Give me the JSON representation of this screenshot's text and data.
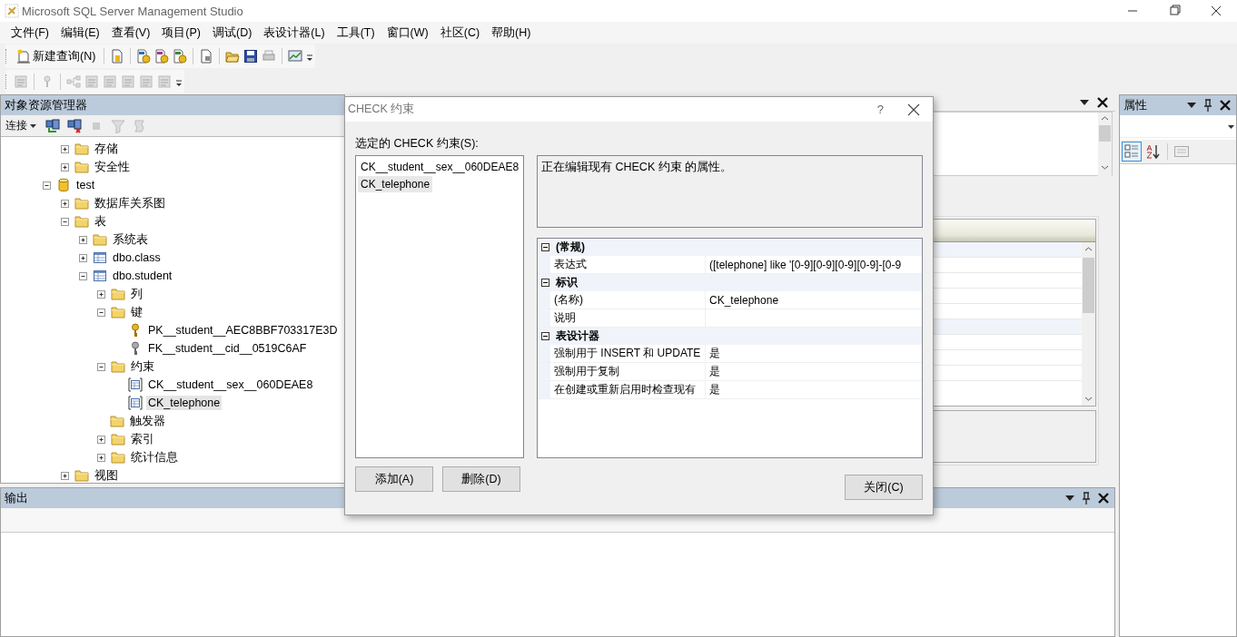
{
  "window": {
    "title": "Microsoft SQL Server Management Studio"
  },
  "menu": [
    {
      "label": "文件(F)"
    },
    {
      "label": "编辑(E)"
    },
    {
      "label": "查看(V)"
    },
    {
      "label": "项目(P)"
    },
    {
      "label": "调试(D)"
    },
    {
      "label": "表设计器(L)"
    },
    {
      "label": "工具(T)"
    },
    {
      "label": "窗口(W)"
    },
    {
      "label": "社区(C)"
    },
    {
      "label": "帮助(H)"
    }
  ],
  "toolbar": {
    "new_query": "新建查询(N)"
  },
  "object_explorer": {
    "title": "对象资源管理器",
    "connect": "连接",
    "tree": {
      "items_above": [
        {
          "label": "存储",
          "kind": "folder",
          "expanded": false
        },
        {
          "label": "安全性",
          "kind": "folder",
          "expanded": false
        }
      ],
      "items": [
        {
          "label": "test",
          "kind": "database",
          "expanded": true,
          "children": [
            {
              "label": "数据库关系图",
              "kind": "folder",
              "expanded": false
            },
            {
              "label": "表",
              "kind": "folder",
              "expanded": true,
              "children": [
                {
                  "label": "系统表",
                  "kind": "folder",
                  "expanded": false
                },
                {
                  "label": "dbo.class",
                  "kind": "table",
                  "expanded": false
                },
                {
                  "label": "dbo.student",
                  "kind": "table",
                  "expanded": true,
                  "children": [
                    {
                      "label": "列",
                      "kind": "folder",
                      "expanded": false
                    },
                    {
                      "label": "键",
                      "kind": "folder",
                      "expanded": true,
                      "children": [
                        {
                          "label": "PK__student__AEC8BBF703317E3D",
                          "kind": "primary_key",
                          "selected": false
                        },
                        {
                          "label": "FK__student__cid__0519C6AF",
                          "kind": "foreign_key",
                          "selected": false
                        }
                      ]
                    },
                    {
                      "label": "约束",
                      "kind": "folder",
                      "expanded": true,
                      "children": [
                        {
                          "label": "CK__student__sex__060DEAE8",
                          "kind": "constraint",
                          "selected": false
                        },
                        {
                          "label": "CK_telephone",
                          "kind": "constraint",
                          "selected": true
                        }
                      ]
                    },
                    {
                      "label": "触发器",
                      "kind": "folder"
                    },
                    {
                      "label": "索引",
                      "kind": "folder",
                      "expanded": false
                    },
                    {
                      "label": "统计信息",
                      "kind": "folder",
                      "expanded": false
                    }
                  ]
                }
              ]
            },
            {
              "label": "视图",
              "kind": "folder",
              "expanded": false
            }
          ]
        }
      ]
    }
  },
  "output_panel": {
    "title": "输出"
  },
  "properties_panel": {
    "title": "属性"
  },
  "dialog": {
    "title": "CHECK 约束",
    "help": "?",
    "list_label": "选定的 CHECK 约束(S):",
    "constraints": [
      {
        "label": "CK__student__sex__060DEAE8",
        "selected": false
      },
      {
        "label": "CK_telephone",
        "selected": true
      }
    ],
    "description": "正在编辑现有 CHECK 约束 的属性。",
    "property_grid": [
      {
        "category": "(常规)",
        "expanded": true,
        "rows": [
          {
            "name": "表达式",
            "value": "([telephone] like '[0-9][0-9][0-9][0-9]-[0-9"
          }
        ]
      },
      {
        "category": "标识",
        "expanded": true,
        "rows": [
          {
            "name": "(名称)",
            "value": "CK_telephone"
          },
          {
            "name": "说明"
          }
        ]
      },
      {
        "category": "表设计器",
        "expanded": true,
        "rows": [
          {
            "name": "强制用于 INSERT 和 UPDATE",
            "value": "是"
          },
          {
            "name": "强制用于复制",
            "value": "是"
          },
          {
            "name": "在创建或重新启用时检查现有",
            "value": "是"
          }
        ]
      }
    ],
    "buttons": {
      "add": "添加(A)",
      "delete": "删除(D)",
      "close": "关闭(C)"
    }
  }
}
